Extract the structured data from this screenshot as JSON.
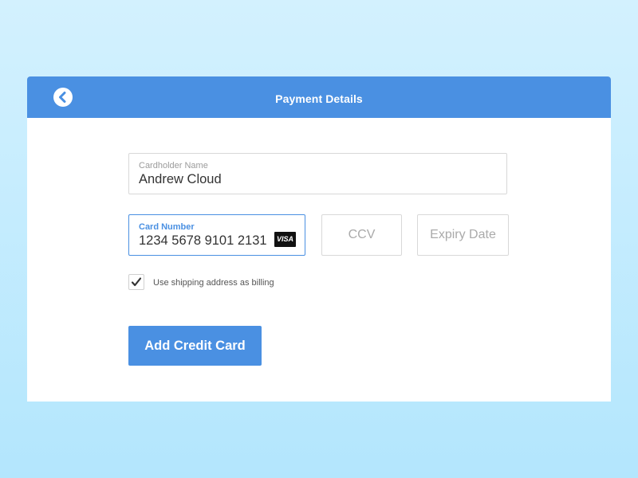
{
  "header": {
    "title": "Payment Details",
    "back_icon": "chevron-left-circle-icon"
  },
  "form": {
    "cardholder": {
      "label": "Cardholder Name",
      "value": "Andrew Cloud"
    },
    "card_number": {
      "label": "Card Number",
      "value": "1234 5678 9101 2131",
      "brand": "VISA"
    },
    "ccv": {
      "placeholder": "CCV"
    },
    "expiry": {
      "placeholder": "Expiry Date"
    },
    "billing_checkbox": {
      "label": "Use shipping address as billing",
      "checked": true
    },
    "submit_label": "Add Credit Card"
  },
  "colors": {
    "accent": "#4a90e2",
    "background_top": "#d3f1fe",
    "background_bottom": "#b3e6fd",
    "border": "#d8d8d8"
  }
}
